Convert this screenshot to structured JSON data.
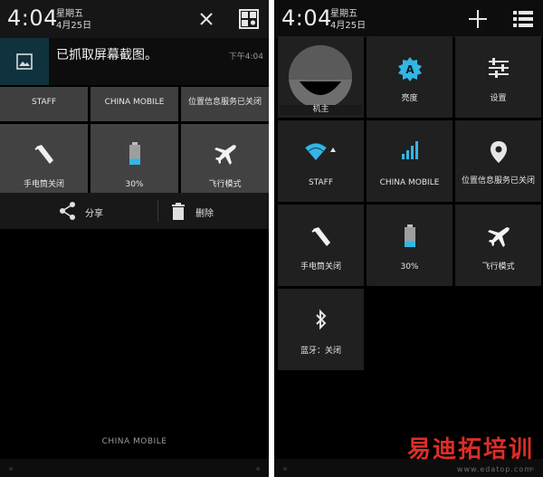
{
  "left": {
    "status": {
      "time": "4:04",
      "weekday": "星期五",
      "date": "4月25日"
    },
    "notification": {
      "title": "已抓取屏幕截图。",
      "time": "下午4:04"
    },
    "quick_tiles": [
      {
        "label": "STAFF"
      },
      {
        "label": "CHINA MOBILE"
      },
      {
        "label": "位置信息服务已关闭"
      },
      {
        "label": "手电筒关闭",
        "icon": "flashlight-icon"
      },
      {
        "label": "30%",
        "icon": "battery-icon"
      },
      {
        "label": "飞行模式",
        "icon": "airplane-icon"
      }
    ],
    "actions": {
      "share": "分享",
      "delete": "删除"
    },
    "carrier": "CHINA MOBILE"
  },
  "right": {
    "status": {
      "time": "4:04",
      "weekday": "星期五",
      "date": "4月25日"
    },
    "tiles": [
      {
        "label": "机主",
        "icon": "avatar"
      },
      {
        "label": "亮度",
        "icon": "brightness-auto-icon"
      },
      {
        "label": "设置",
        "icon": "settings-sliders-icon"
      },
      {
        "label": "STAFF",
        "icon": "wifi-icon"
      },
      {
        "label": "CHINA MOBILE",
        "icon": "signal-icon"
      },
      {
        "label": "位置信息服务已关闭",
        "icon": "location-icon"
      },
      {
        "label": "手电筒关闭",
        "icon": "flashlight-icon"
      },
      {
        "label": "30%",
        "icon": "battery-icon"
      },
      {
        "label": "飞行模式",
        "icon": "airplane-icon"
      },
      {
        "label": "蓝牙：关闭",
        "icon": "bluetooth-icon"
      }
    ]
  },
  "colors": {
    "accent": "#33b5e5",
    "tile_dark": "#202020",
    "tile_gray": "#3f3f3f"
  },
  "battery_level": 0.3,
  "watermark": {
    "main": "易迪拓培训",
    "sub": "www.edatop.com"
  }
}
